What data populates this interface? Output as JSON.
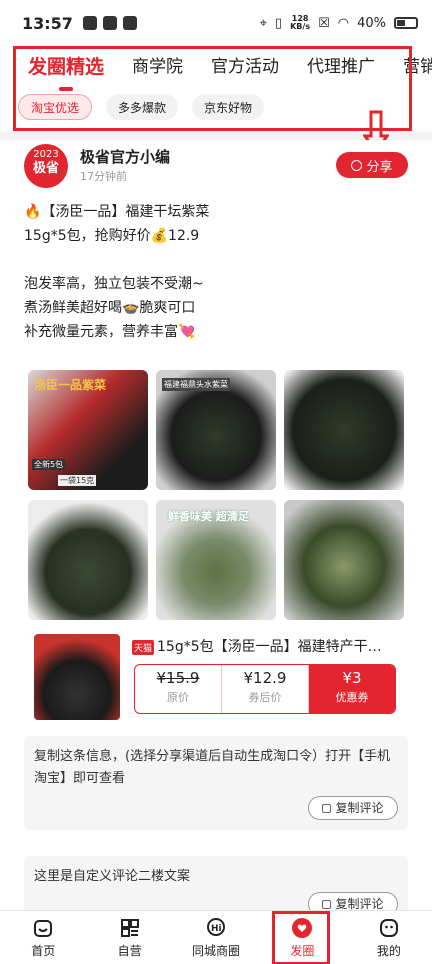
{
  "status": {
    "time": "13:57",
    "net_speed_top": "128",
    "net_speed_bottom": "KB/s",
    "battery": "40%"
  },
  "tabs": [
    "发圈精选",
    "商学院",
    "官方活动",
    "代理推广",
    "营销"
  ],
  "chips": [
    "淘宝优选",
    "多多爆款",
    "京东好物"
  ],
  "post": {
    "avatar_year": "2023",
    "avatar_name": "极省",
    "author": "极省官方小编",
    "time_ago": "17分钟前",
    "share_label": "分享",
    "lines": [
      "🔥【汤臣一品】福建干坛紫菜",
      "15g*5包，抢购好价💰12.9",
      "",
      "泡发率高，独立包装不受潮~",
      "煮汤鲜美超好喝🍲脆爽可口",
      "补充微量元素，营养丰富💘"
    ],
    "thumb_texts": [
      "汤臣一品紫菜",
      "全新5包",
      "一袋15克",
      "福建福鼎头水紫菜",
      "鲜香味美 超清足"
    ]
  },
  "product": {
    "tag": "天猫",
    "title": "15g*5包【汤臣一品】福建特产干…",
    "original_price": "¥15.9",
    "original_label": "原价",
    "after_price": "¥12.9",
    "after_label": "券后价",
    "coupon_value": "¥3",
    "coupon_label": "优惠券"
  },
  "comments": [
    {
      "text": "复制这条信息，(选择分享渠道后自动生成淘口令）打开【手机淘宝】即可查看",
      "button": "复制评论"
    },
    {
      "text": "这里是自定义评论二楼文案",
      "button": "复制评论"
    }
  ],
  "nav": [
    {
      "label": "首页",
      "icon": "home-icon"
    },
    {
      "label": "自营",
      "icon": "grid-icon"
    },
    {
      "label": "同城商圈",
      "icon": "chat-hi-icon"
    },
    {
      "label": "发圈",
      "icon": "heart-circle-icon"
    },
    {
      "label": "我的",
      "icon": "smile-face-icon"
    }
  ],
  "colors": {
    "accent": "#e2252f"
  }
}
